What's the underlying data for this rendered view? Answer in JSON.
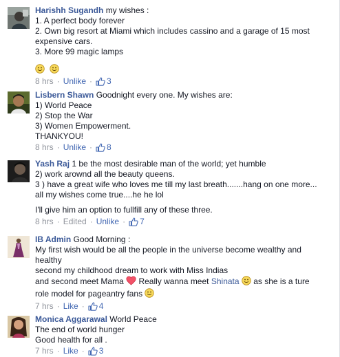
{
  "comments": [
    {
      "name": "Harishh Sugandh",
      "lines": [
        "my wishes :",
        "1. A perfect body forever",
        "2. Own big resort at Miami which includes cassino and a garage of 15 most",
        "expensive cars.",
        "3. More 99 magic lamps"
      ],
      "time": "8 hrs",
      "action": "Unlike",
      "likes": "3"
    },
    {
      "name": "Lisbern Shawn",
      "lines": [
        "Goodnight every one. My wishes are:",
        "1) World Peace",
        "2) Stop the War",
        "3) Women Empowerment.",
        "THANKYOU!"
      ],
      "time": "8 hrs",
      "action": "Unlike",
      "likes": "8"
    },
    {
      "name": "Yash Raj",
      "lines": [
        "1 be the most desirable man of the world; yet humble",
        "2) work arownd all the beauty queens.",
        "3 ) have a great wife who loves me till my last breath.......hang on one more...",
        "all my wishes come true....he he lol",
        "I'll give him an option to fullfill any of these three."
      ],
      "time": "8 hrs",
      "edited": "Edited",
      "action": "Unlike",
      "likes": "7"
    },
    {
      "name": "IB Admin",
      "lines": [
        "Good Morning :",
        "My first wish would be all the people in the universe become wealthy and",
        "healthy",
        "second my childhood dream to work with Miss Indias",
        "and second meet Mama",
        "Really wanna meet",
        "Shinata",
        "as she is a ture",
        "role model for pageantry fans"
      ],
      "time": "7 hrs",
      "action": "Like",
      "likes": "4"
    },
    {
      "name": "Monica Aggarawal",
      "lines": [
        "World Peace",
        "The end of world hunger",
        "Good health for all ."
      ],
      "time": "7 hrs",
      "action": "Like",
      "likes": "3"
    }
  ],
  "separator": "·",
  "colors": {
    "name": "#3b5998",
    "link": "#4267b2",
    "meta": "#90949c",
    "text": "#141823"
  },
  "icons": [
    "smiley-icon",
    "heart-icon",
    "thumbs-up-icon"
  ]
}
